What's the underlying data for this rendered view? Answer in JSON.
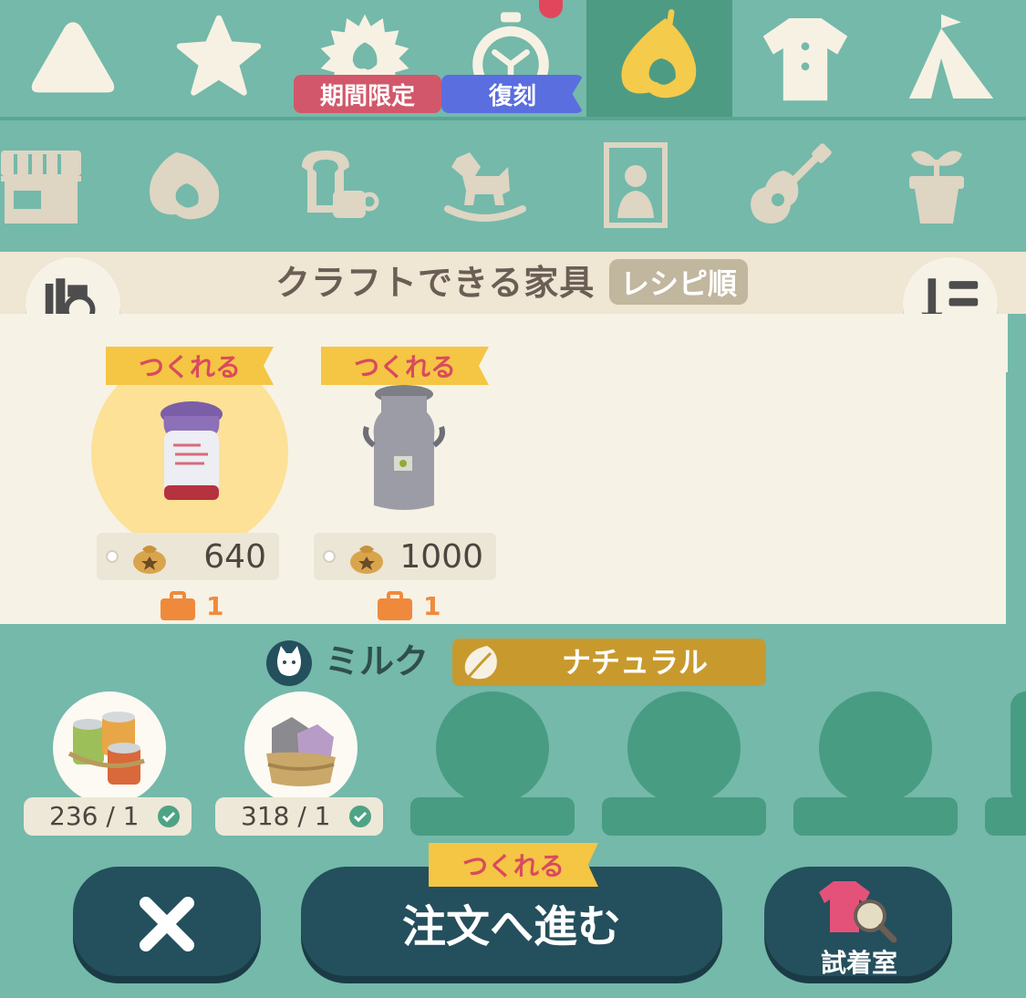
{
  "top_tabs": [
    {
      "name": "triangle-icon"
    },
    {
      "name": "star-icon"
    },
    {
      "name": "limited-time-icon"
    },
    {
      "name": "revival-clock-icon"
    },
    {
      "name": "leaf-icon",
      "active": true
    },
    {
      "name": "shirt-icon"
    },
    {
      "name": "tent-icon"
    }
  ],
  "badges": {
    "limited": "期間限定",
    "revival": "復刻"
  },
  "categories": [
    {
      "name": "shop-icon"
    },
    {
      "name": "fruit-icon"
    },
    {
      "name": "bread-cup-icon"
    },
    {
      "name": "rocking-horse-icon"
    },
    {
      "name": "painting-icon"
    },
    {
      "name": "guitar-icon"
    },
    {
      "name": "plant-pot-icon"
    }
  ],
  "header": {
    "title": "クラフトできる家具",
    "sort": "レシピ順"
  },
  "items": [
    {
      "ribbon": "つくれる",
      "price": "640",
      "bag_count": "1",
      "selected": true
    },
    {
      "ribbon": "つくれる",
      "price": "1000",
      "bag_count": "1",
      "selected": false
    }
  ],
  "villager": {
    "name": "ミルク",
    "style": "ナチュラル"
  },
  "materials": [
    {
      "count": "236 / 1",
      "icon": "cans-icon"
    },
    {
      "count": "318 / 1",
      "icon": "rocks-icon"
    }
  ],
  "actions": {
    "ribbon": "つくれる",
    "order": "注文へ進む",
    "fitting": "試着室"
  },
  "colors": {
    "accent": "#74b9aa",
    "dark_button": "#244f5d",
    "ribbon": "#f5c544",
    "style": "#c89a2e"
  }
}
